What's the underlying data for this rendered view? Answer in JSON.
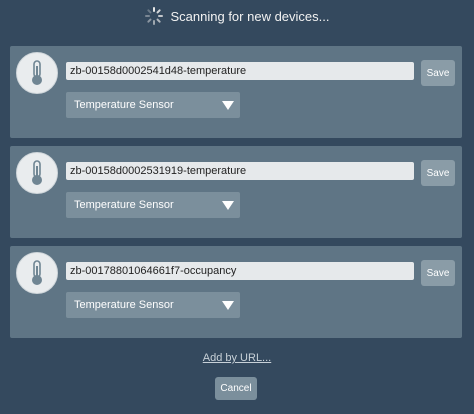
{
  "header": {
    "status_text": "Scanning for new devices...",
    "spinner_icon": "loading-spinner-icon"
  },
  "devices": [
    {
      "icon": "thermometer-icon",
      "name": "zb-00158d0002541d48-temperature",
      "type": "Temperature Sensor",
      "save_label": "Save"
    },
    {
      "icon": "thermometer-icon",
      "name": "zb-00158d0002531919-temperature",
      "type": "Temperature Sensor",
      "save_label": "Save"
    },
    {
      "icon": "thermometer-icon",
      "name": "zb-00178801064661f7-occupancy",
      "type": "Temperature Sensor",
      "save_label": "Save"
    }
  ],
  "footer": {
    "add_by_url_label": "Add by URL...",
    "cancel_label": "Cancel"
  },
  "colors": {
    "background": "#34495e",
    "card": "#5f7585",
    "button": "#8a9ca7"
  }
}
